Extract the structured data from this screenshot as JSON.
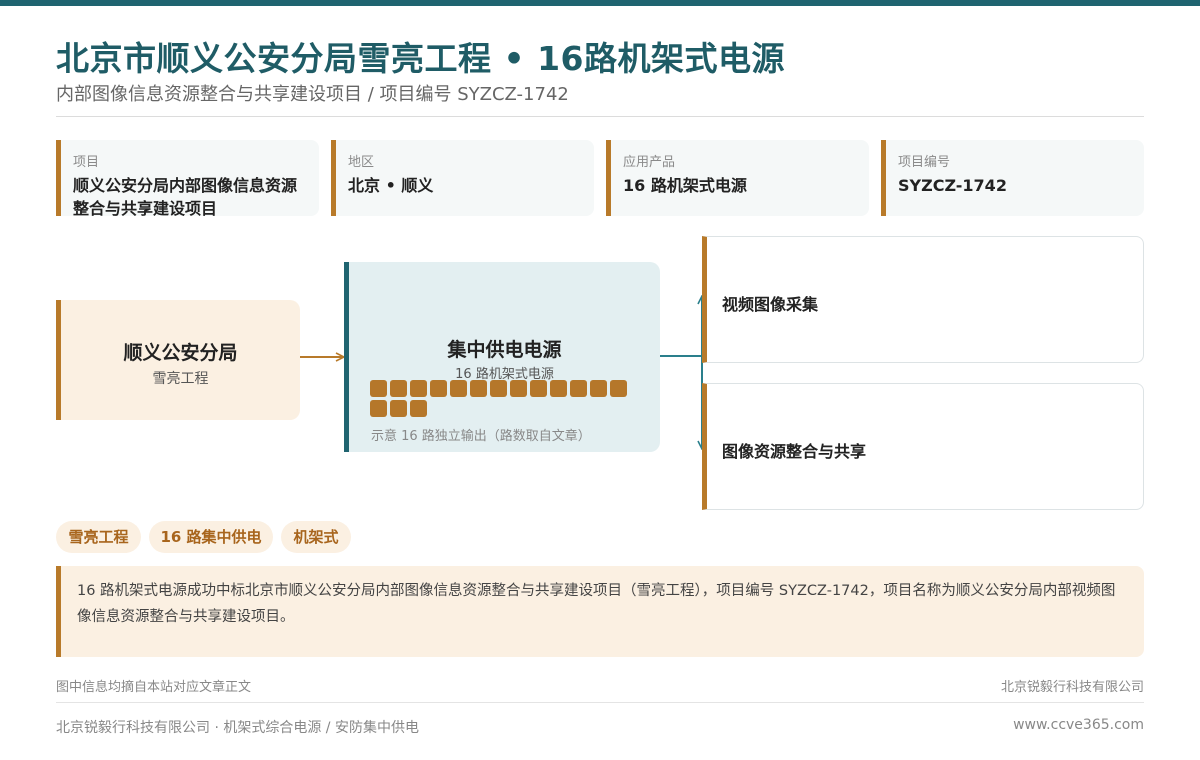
{
  "header": {
    "title": "北京市顺义公安分局雪亮工程 • 16路机架式电源",
    "subtitle": "内部图像信息资源整合与共享建设项目 / 项目编号 SYZCZ-1742"
  },
  "info_cards": [
    {
      "label": "项目",
      "value": "顺义公安分局内部图像信息资源整合与共享建设项目"
    },
    {
      "label": "地区",
      "value": "北京 • 顺义"
    },
    {
      "label": "应用产品",
      "value": "16 路机架式电源"
    },
    {
      "label": "项目编号",
      "value": "SYZCZ-1742"
    }
  ],
  "diagram": {
    "source": {
      "title": "顺义公安分局",
      "subtitle": "雪亮工程"
    },
    "power_supply": {
      "title": "集中供电电源",
      "subtitle": "16 路机架式电源",
      "port_count": 16,
      "note": "示意 16 路独立输出（路数取自文章）"
    },
    "outputs": [
      {
        "title": "视频图像采集"
      },
      {
        "title": "图像资源整合与共享"
      }
    ]
  },
  "tags": [
    "雪亮工程",
    "16 路集中供电",
    "机架式"
  ],
  "description": "16 路机架式电源成功中标北京市顺义公安分局内部图像信息资源整合与共享建设项目（雪亮工程），项目编号 SYZCZ-1742，项目名称为顺义公安分局内部视频图像信息资源整合与共享建设项目。",
  "notes": {
    "source_note": "图中信息均摘自本站对应文章正文",
    "company_note": "北京锐毅行科技有限公司"
  },
  "footer": {
    "left": "北京锐毅行科技有限公司 · 机架式综合电源 / 安防集中供电",
    "right": "www.ccve365.com"
  },
  "colors": {
    "primary": "#1f6470",
    "accent": "#b87a2a",
    "accent_light": "#fbf0e2",
    "teal_light": "#e3eff1"
  }
}
